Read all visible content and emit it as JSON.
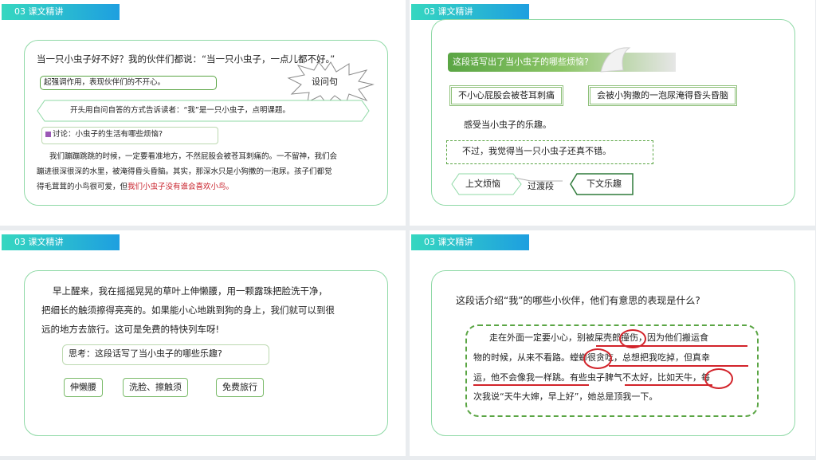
{
  "header_label": "03  课文精讲",
  "slide1": {
    "question": "当一只小虫子好不好？我的伙伴们都说：“当一只小虫子，一点儿都不好。”",
    "note_emphasis": "起强调作用，表现伙伴们的不开心。",
    "burst_label": "设问句",
    "note_intro": "开头用自问自答的方式告诉读者：“我”是一只小虫子，点明课题。",
    "discussion": "讨论：小虫子的生活有哪些烦恼?",
    "para_lines": [
      "我们蹦蹦跳跳的时候，一定要看准地方，不然屁股会被苍耳刺痛的。一不留神，我们会",
      "蹦进很深很深的水里，被淹得昏头昏脑。其实，那深水只是小狗撒的一泡尿。孩子们都觉"
    ],
    "para_last": "得毛茸茸的小鸟很可爱，但",
    "para_red": "我们小虫子没有谁会喜欢小鸟。"
  },
  "slide2": {
    "banner": "这段话写出了当小虫子的哪些烦恼?",
    "box_left": "不小心屁股会被苍耳刺痛",
    "box_right": "会被小狗撒的一泡尿淹得昏头昏脑",
    "fun": "感受当小虫子的乐趣。",
    "quote": "不过，我觉得当一只小虫子还真不错。",
    "arrow_left": "上文烦恼",
    "arrow_mid": "过渡段",
    "arrow_right": "下文乐趣"
  },
  "slide3": {
    "para_lines": [
      "早上醒来，我在摇摇晃晃的草叶上伸懒腰，用一颗露珠把脸洗干净，",
      "把细长的触须擦得亮亮的。如果能小心地跳到狗的身上，我们就可以到很",
      "远的地方去旅行。这可是免费的特快列车呀!"
    ],
    "think": "思考：这段话写了当小虫子的哪些乐趣?",
    "tags": [
      "伸懒腰",
      "洗脸、擦触须",
      "免费旅行"
    ]
  },
  "slide4": {
    "question": "这段话介绍“我”的哪些小伙伴，他们有意思的表现是什么?",
    "para_lines": [
      "走在外面一定要小心，别被屎壳郎撞伤，因为他们搬运食",
      "物的时候，从来不看路。螳螂很贪吃，总想把我吃掉，但真幸",
      "运，他不会像我一样跳。有些虫子脾气不太好，比如天牛，每",
      "次我说“天牛大婶，早上好”，她总是顶我一下。"
    ]
  },
  "colors": {
    "accent_green": "#5aa544",
    "panel_border": "#8fd9a6",
    "header_start": "#36d7c0",
    "header_end": "#1e9fe0",
    "highlight_red": "#c8202a"
  }
}
